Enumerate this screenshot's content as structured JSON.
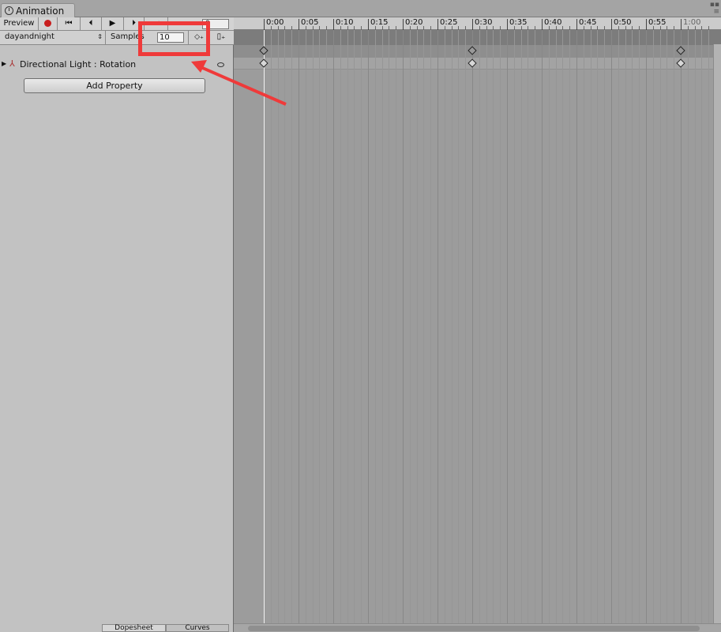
{
  "window": {
    "tab_title": "Animation"
  },
  "toolbar": {
    "preview_label": "Preview",
    "time_value": "0"
  },
  "clip": {
    "name": "dayandnight",
    "samples_label": "Samples",
    "samples_value": "10"
  },
  "property": {
    "name": "Directional Light : Rotation"
  },
  "add_property_label": "Add Property",
  "bottom_tabs": [
    "Dopesheet",
    "Curves"
  ],
  "ruler": {
    "ticks": [
      "0:00",
      "0:05",
      "0:10",
      "0:15",
      "0:20",
      "0:25",
      "0:30",
      "0:35",
      "0:40",
      "0:45",
      "0:50",
      "0:55",
      "1:00"
    ]
  },
  "keyframes_at": [
    "0:00",
    "0:30",
    "1:00"
  ],
  "colors": {
    "highlight": "#ef3a3a",
    "panel": "#c2c2c2",
    "timeline": "#9c9c9c"
  }
}
